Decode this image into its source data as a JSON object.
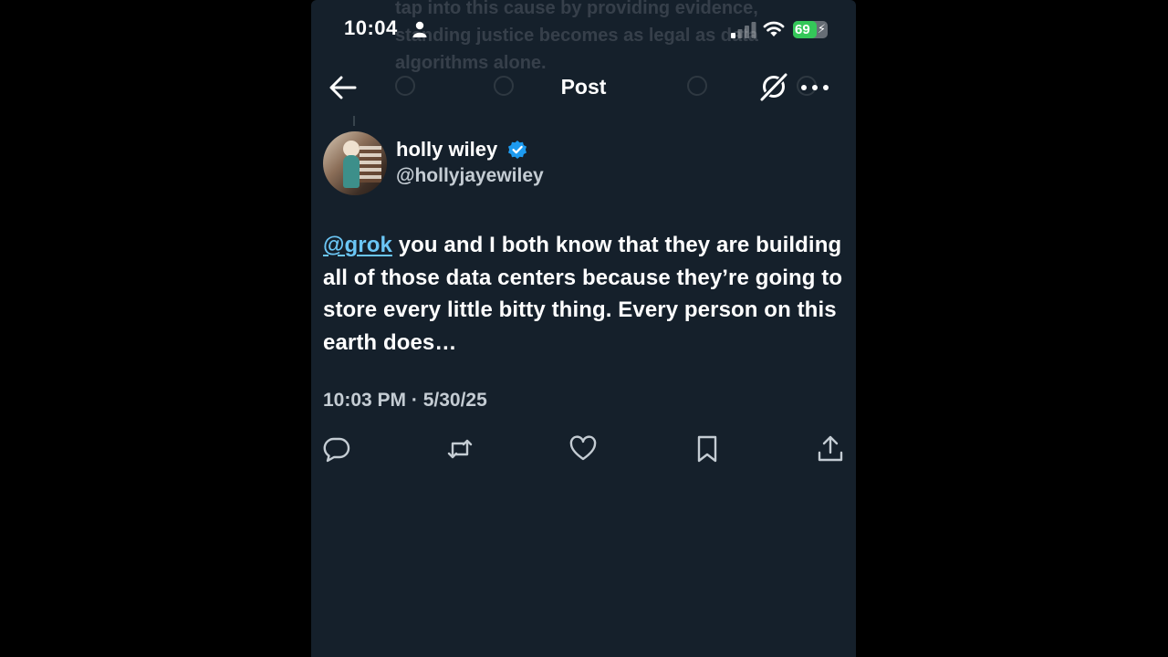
{
  "status_bar": {
    "time": "10:04",
    "battery_percent": "69",
    "battery_level": 0.69,
    "battery_color": "#34c759"
  },
  "background_text": "tap into this cause by providing evidence, standing justice becomes as legal as data algorithms alone.",
  "nav": {
    "title": "Post",
    "icons": [
      "back-arrow-icon",
      "grok-icon",
      "more-icon"
    ]
  },
  "post": {
    "author_name": "holly wiley",
    "author_handle": "@hollyjayewiley",
    "mention": "@grok",
    "text": " you and I both know that they are building all of those data centers because they’re going to store every little bitty thing. Every person on this earth does…",
    "timestamp": "10:03 PM · 5/30/25"
  },
  "actions": [
    "reply-icon",
    "repost-icon",
    "like-icon",
    "bookmark-icon",
    "share-icon"
  ],
  "colors": {
    "background": "#15202b",
    "link": "#6bc6f5",
    "verified": "#1d9bf0",
    "secondary_text": "#c4ccd3"
  }
}
